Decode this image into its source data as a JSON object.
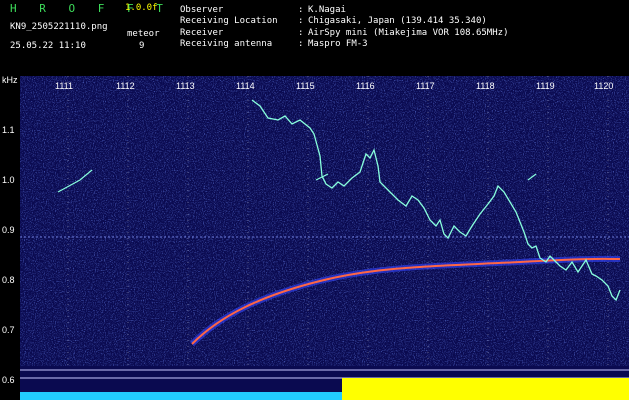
{
  "header": {
    "brand": "H R O F F T",
    "version": "1.0.0f",
    "filename": "KN9_2505221110.png",
    "datetime": "25.05.22 11:10",
    "meteor_label": "meteor",
    "meteor_count": "9",
    "fields": [
      {
        "key": "Observer",
        "sep": ":",
        "value": "K.Nagai"
      },
      {
        "key": "Receiving Location",
        "sep": ":",
        "value": "Chigasaki, Japan (139.414 35.340)"
      },
      {
        "key": "Receiver",
        "sep": ":",
        "value": "AirSpy mini (Miakejima VOR 108.65MHz)"
      },
      {
        "key": "Receiving antenna",
        "sep": ":",
        "value": "Maspro FM-3"
      }
    ]
  },
  "spectrogram": {
    "y_unit": "kHz",
    "y_ticks": [
      "1.1",
      "1.0",
      "0.9",
      "0.8",
      "0.7",
      "0.6"
    ],
    "x_ticks": [
      "1111",
      "1112",
      "1113",
      "1114",
      "1115",
      "1116",
      "1117",
      "1118",
      "1119",
      "1120"
    ],
    "colors": {
      "background": "#0a0a50",
      "trace_main": "#ff6644",
      "trace_secondary": "#88ffdd",
      "level_low": "#22ccff",
      "level_high": "#ffff00"
    }
  }
}
